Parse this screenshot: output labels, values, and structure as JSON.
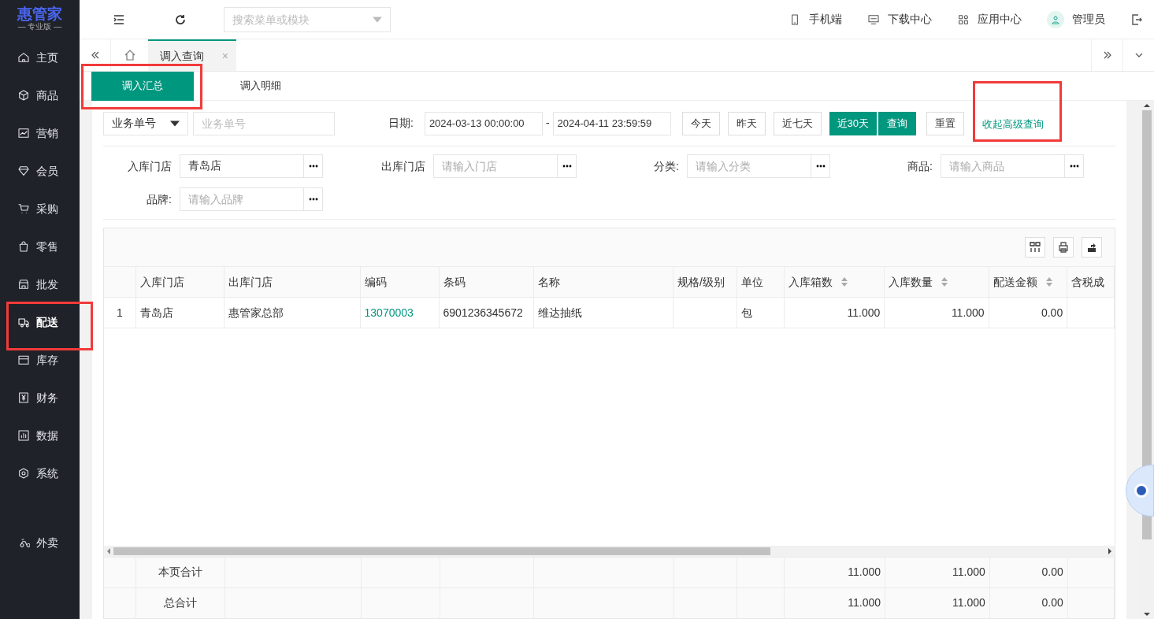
{
  "logo": {
    "title": "惠管家",
    "subtitle": "— 专业版 —"
  },
  "sidebar": {
    "items": [
      {
        "label": "主页",
        "selected": false,
        "highlighted": false
      },
      {
        "label": "商品",
        "selected": false,
        "highlighted": false
      },
      {
        "label": "营销",
        "selected": false,
        "highlighted": false
      },
      {
        "label": "会员",
        "selected": false,
        "highlighted": false
      },
      {
        "label": "采购",
        "selected": false,
        "highlighted": false
      },
      {
        "label": "零售",
        "selected": false,
        "highlighted": false
      },
      {
        "label": "批发",
        "selected": false,
        "highlighted": false
      },
      {
        "label": "配送",
        "selected": true,
        "highlighted": true
      },
      {
        "label": "库存",
        "selected": false,
        "highlighted": false
      },
      {
        "label": "财务",
        "selected": false,
        "highlighted": false
      },
      {
        "label": "数据",
        "selected": false,
        "highlighted": false
      },
      {
        "label": "系统",
        "selected": false,
        "highlighted": false
      }
    ],
    "bottom_items": [
      {
        "label": "外卖",
        "selected": false,
        "highlighted": false
      }
    ]
  },
  "topbar": {
    "search": {
      "placeholder": "搜索菜单或模块"
    },
    "links": [
      {
        "label": "手机端",
        "kind": "phone"
      },
      {
        "label": "下载中心",
        "kind": "monitor"
      },
      {
        "label": "应用中心",
        "kind": "apps"
      },
      {
        "label": "管理员",
        "kind": "user"
      }
    ]
  },
  "tabs": [
    {
      "label": "调入查询",
      "selected": true,
      "close": "×"
    }
  ],
  "sub_tabs": [
    {
      "label": "调入汇总",
      "selected": true,
      "highlighted": true
    },
    {
      "label": "调入明细",
      "selected": false,
      "highlighted": false
    }
  ],
  "filters": {
    "type_select": "业务单号",
    "type_placeholder": "业务单号",
    "date_label": "日期:",
    "date_from": "2024-03-13 00:00:00",
    "date_sep": "-",
    "date_to": "2024-04-11 23:59:59",
    "quick": [
      {
        "label": "今天",
        "selected": false
      },
      {
        "label": "昨天",
        "selected": false
      },
      {
        "label": "近七天",
        "selected": false
      },
      {
        "label": "近30天",
        "selected": true
      }
    ],
    "query": "查询",
    "reset": "重置",
    "advanced": {
      "label": "收起高级查询",
      "highlighted": true
    },
    "fields": [
      {
        "label": "入库门店",
        "value": "青岛店"
      },
      {
        "label": "出库门店",
        "placeholder": "请输入门店"
      },
      {
        "label": "分类:",
        "placeholder": "请输入分类"
      },
      {
        "label": "商品:",
        "placeholder": "请输入商品"
      },
      {
        "label": "品牌:",
        "placeholder": "请输入品牌"
      }
    ]
  },
  "table": {
    "columns": [
      {},
      {
        "label": "入库门店"
      },
      {
        "label": "出库门店"
      },
      {
        "label": "编码"
      },
      {
        "label": "条码"
      },
      {
        "label": "名称"
      },
      {
        "label": "规格/级别"
      },
      {
        "label": "单位"
      },
      {
        "label": "入库箱数",
        "sortable": true
      },
      {
        "label": "入库数量",
        "sortable": true
      },
      {
        "label": "配送金额",
        "sortable": true
      },
      {
        "label": "含税成"
      }
    ],
    "rows": [
      {
        "row_number": "1",
        "in_store": "青岛店",
        "out_store": "惠管家总部",
        "code": "13070003",
        "barcode": "6901236345672",
        "name": "维达抽纸",
        "unit": "包",
        "in_boxes": "11.000",
        "in_qty": "11.000",
        "amount": "0.00"
      }
    ],
    "footer": [
      {
        "in_store": "本页合计",
        "in_boxes": "11.000",
        "in_qty": "11.000",
        "amount": "0.00"
      },
      {
        "in_store": "总合计",
        "in_boxes": "11.000",
        "in_qty": "11.000",
        "amount": "0.00"
      }
    ]
  }
}
